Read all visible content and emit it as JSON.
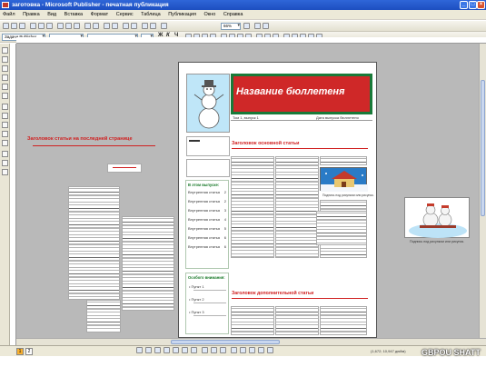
{
  "window": {
    "title": "заготовка - Microsoft Publisher - печатная публикация"
  },
  "menu": [
    "Файл",
    "Правка",
    "Вид",
    "Вставка",
    "Формат",
    "Сервис",
    "Таблица",
    "Публикация",
    "Окно",
    "Справка"
  ],
  "toolbar": {
    "task_pane_label": "Задачи Publisher",
    "zoom": "66%"
  },
  "document": {
    "newsletter_title": "Название бюллетеня",
    "issue_label": "Том 1, выпуск 1",
    "date_label": "Дата выпуска бюллетеня",
    "main_heading": "Заголовок основной статьи",
    "secondary_heading": "Заголовок дополнительной статьи",
    "back_page_heading": "Заголовок статьи на последней странице",
    "contents_heading": "В этом выпуске:",
    "special_heading": "Особого внимания:",
    "caption_1": "Подпись под рисунком или рисунок.",
    "caption_2": "Подпись под рисунком или рисунок.",
    "contents_items": [
      {
        "label": "Внутренняя статья",
        "page": "2"
      },
      {
        "label": "Внутренняя статья",
        "page": "2"
      },
      {
        "label": "Внутренняя статья",
        "page": "3"
      },
      {
        "label": "Внутренняя статья",
        "page": "4"
      },
      {
        "label": "Внутренняя статья",
        "page": "5"
      },
      {
        "label": "Внутренняя статья",
        "page": "6"
      },
      {
        "label": "Внутренняя статья",
        "page": "6"
      }
    ],
    "special_items": [
      "Пункт 1",
      "Пункт 2",
      "Пункт 3"
    ]
  },
  "status": {
    "pages": [
      "1",
      "2"
    ],
    "coords": "(1,672; 10,947 дюйм)"
  },
  "watermark": "GBPOU SHATT",
  "colors": {
    "title_bar": "#2f66d8",
    "banner": "#cf2828",
    "banner_border": "#197a39",
    "headings": "#d02020"
  }
}
